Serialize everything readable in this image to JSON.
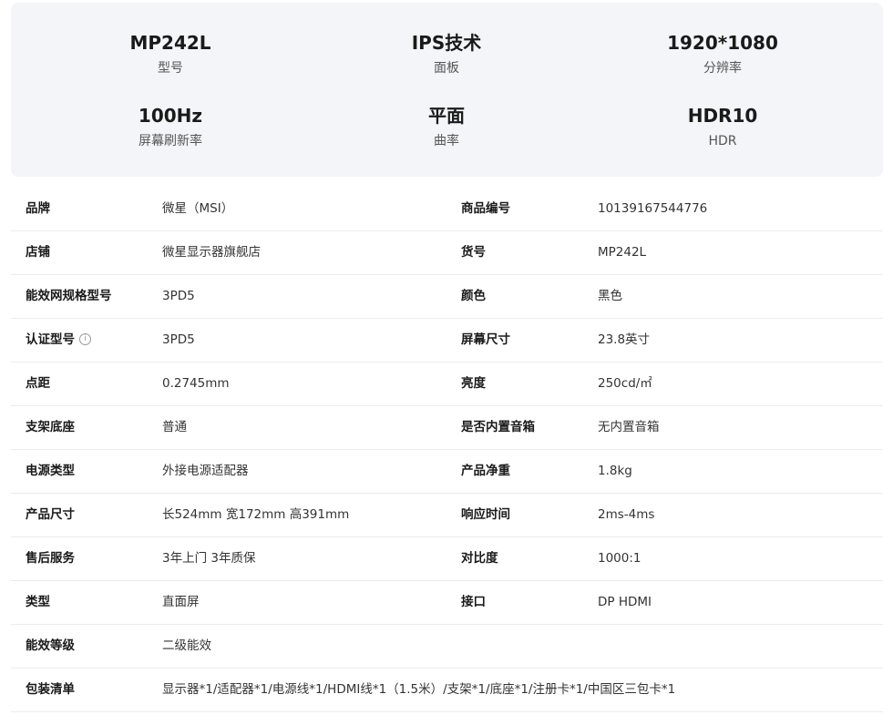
{
  "highlights": [
    {
      "value": "MP242L",
      "label": "型号"
    },
    {
      "value": "IPS技术",
      "label": "面板"
    },
    {
      "value": "1920*1080",
      "label": "分辨率"
    },
    {
      "value": "100Hz",
      "label": "屏幕刷新率"
    },
    {
      "value": "平面",
      "label": "曲率"
    },
    {
      "value": "HDR10",
      "label": "HDR"
    }
  ],
  "specs": [
    {
      "k1": "品牌",
      "v1": "微星（MSI）",
      "k2": "商品编号",
      "v2": "10139167544776"
    },
    {
      "k1": "店铺",
      "v1": "微星显示器旗舰店",
      "k2": "货号",
      "v2": "MP242L"
    },
    {
      "k1": "能效网规格型号",
      "v1": "3PD5",
      "k2": "颜色",
      "v2": "黑色"
    },
    {
      "k1": "认证型号",
      "v1": "3PD5",
      "k2": "屏幕尺寸",
      "v2": "23.8英寸"
    },
    {
      "k1": "点距",
      "v1": "0.2745mm",
      "k2": "亮度",
      "v2": "250cd/㎡"
    },
    {
      "k1": "支架底座",
      "v1": "普通",
      "k2": "是否内置音箱",
      "v2": "无内置音箱"
    },
    {
      "k1": "电源类型",
      "v1": "外接电源适配器",
      "k2": "产品净重",
      "v2": "1.8kg"
    },
    {
      "k1": "产品尺寸",
      "v1": "长524mm 宽172mm 高391mm",
      "k2": "响应时间",
      "v2": "2ms-4ms"
    },
    {
      "k1": "售后服务",
      "v1": "3年上门 3年质保",
      "k2": "对比度",
      "v2": "1000:1"
    },
    {
      "k1": "类型",
      "v1": "直面屏",
      "k2": "接口",
      "v2": "DP HDMI"
    },
    {
      "k1": "能效等级",
      "v1": "二级能效",
      "k2": "",
      "v2": ""
    },
    {
      "k1": "包装清单",
      "v1": "显示器*1/适配器*1/电源线*1/HDMI线*1（1.5米）/支架*1/底座*1/注册卡*1/中国区三包卡*1",
      "k2": "",
      "v2": ""
    }
  ],
  "info_icon": {
    "name": "info-icon",
    "glyph": "i"
  }
}
